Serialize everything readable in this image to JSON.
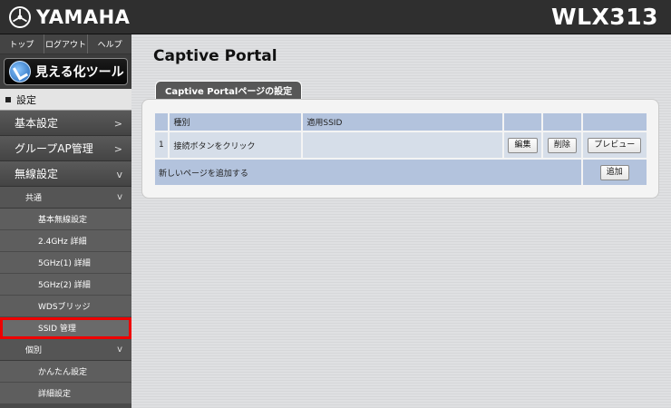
{
  "header": {
    "brand": "YAMAHA",
    "model": "WLX313"
  },
  "sidebar": {
    "top_links": [
      "トップ",
      "ログアウト",
      "ヘルプ"
    ],
    "visualize_button": "見える化ツール",
    "settings_label": "設定",
    "main_items": [
      "基本設定",
      "グループAP管理",
      "無線設定"
    ],
    "common_label": "共通",
    "common_items": [
      "基本無線設定",
      "2.4GHz 詳細",
      "5GHz(1) 詳細",
      "5GHz(2) 詳細",
      "WDSブリッジ",
      "SSID 管理"
    ],
    "individual_label": "個別",
    "individual_items": [
      "かんたん設定",
      "詳細設定"
    ]
  },
  "main": {
    "title": "Captive Portal",
    "tab_label": "Captive Portalページの設定",
    "table": {
      "col_type": "種別",
      "col_ssid": "適用SSID",
      "rows": [
        {
          "index": "1",
          "type": "接続ボタンをクリック",
          "ssid": ""
        }
      ],
      "edit_button": "編集",
      "delete_button": "削除",
      "preview_button": "プレビュー",
      "add_row_label": "新しいページを追加する",
      "add_button": "追加"
    }
  },
  "colors": {
    "header_bg": "#2f2f2f",
    "table_header": "#b3c3dd",
    "table_row": "#d6dee9",
    "highlight": "#e00000"
  }
}
